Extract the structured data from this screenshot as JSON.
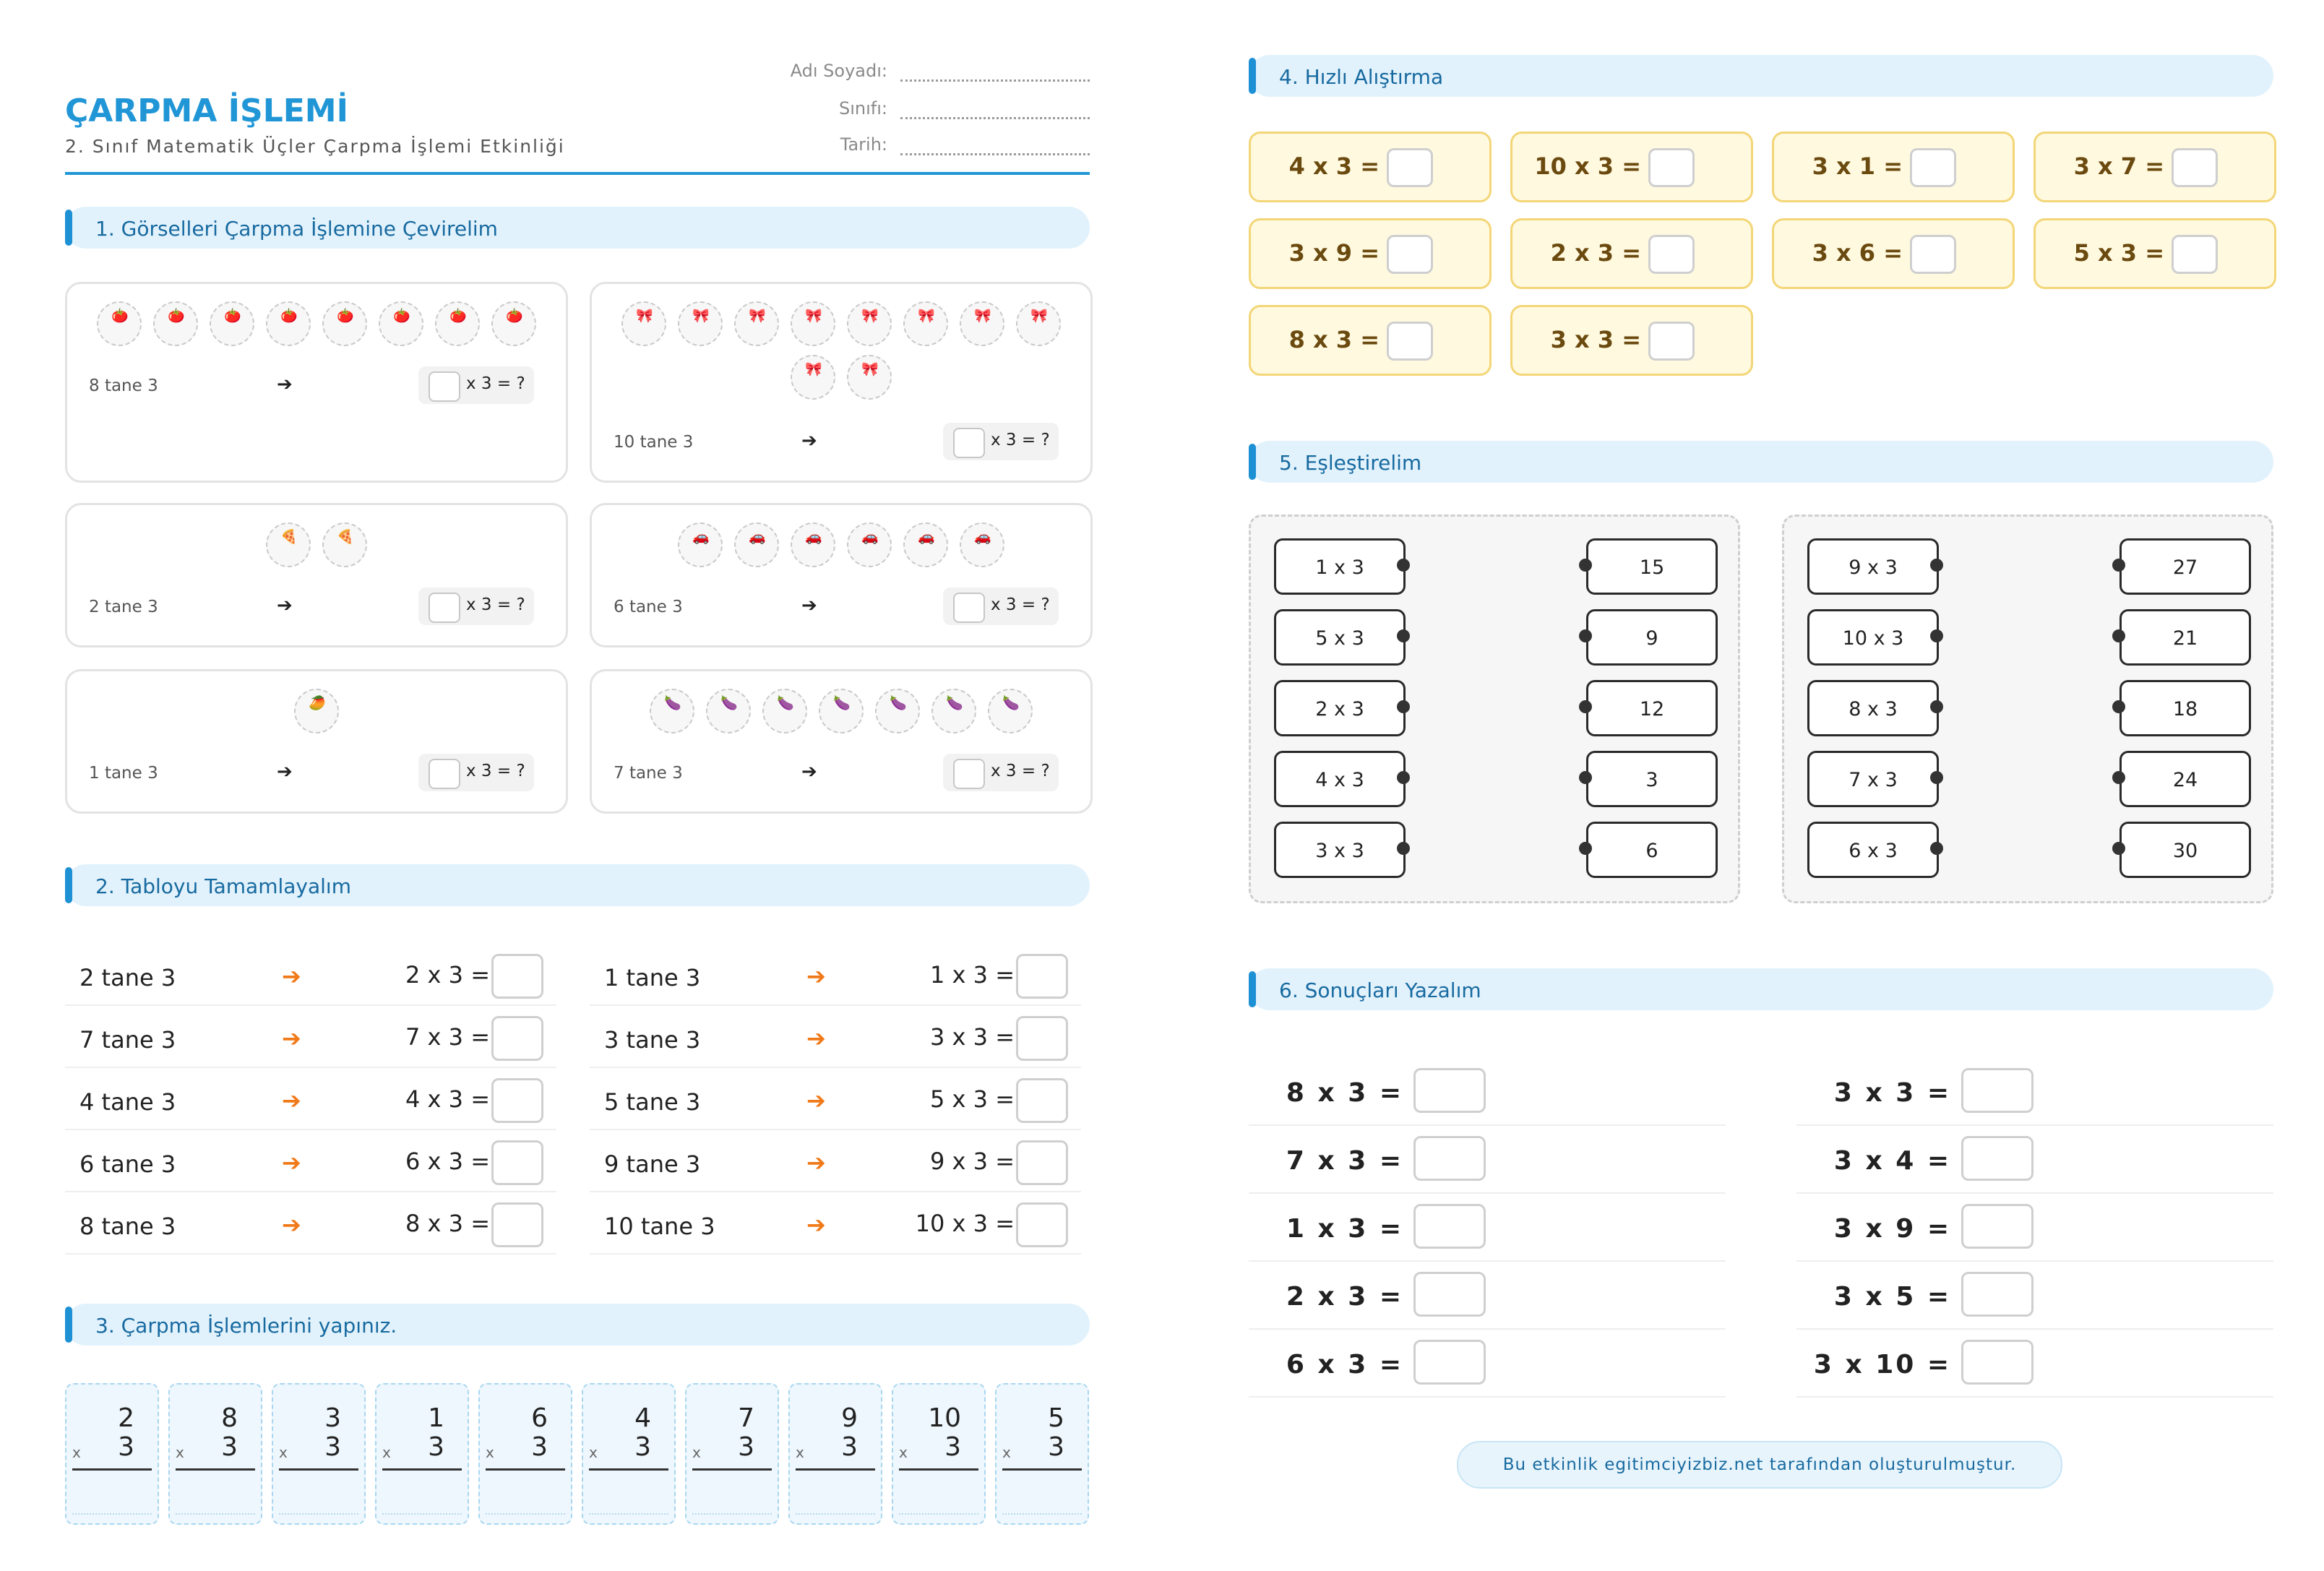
{
  "header": {
    "title": "ÇARPMA İŞLEMİ",
    "subtitle": "2. Sınıf Matematik Üçler Çarpma İşlemi Etkinliği",
    "fields": [
      "Adı Soyadı:",
      "Sınıfı:",
      "Tarih:"
    ]
  },
  "sections": {
    "s1": "1. Görselleri Çarpma İşlemine Çevirelim",
    "s2": "2. Tabloyu Tamamlayalım",
    "s3": "3. Çarpma İşlemlerini yapınız.",
    "s4": "4. Hızlı Alıştırma",
    "s5": "5. Eşleştirelim",
    "s6": "6. Sonuçları Yazalım"
  },
  "colors": {
    "accent": "#2196d6",
    "arrow": "#f07a1a",
    "fast_bg": "#fff9df",
    "fast_border": "#f3d678"
  },
  "arrow_glyph": "➔",
  "picture_cards": [
    {
      "caption": "8 tane 3",
      "question": "x 3 = ?",
      "icon": "🍅",
      "groups": 8
    },
    {
      "caption": "10 tane 3",
      "question": "x 3 = ?",
      "icon": "🎀",
      "groups": 10
    },
    {
      "caption": "2 tane 3",
      "question": "x 3 = ?",
      "icon": "🍕",
      "groups": 2
    },
    {
      "caption": "6 tane 3",
      "question": "x 3 = ?",
      "icon": "🚗",
      "groups": 6
    },
    {
      "caption": "1 tane 3",
      "question": "x 3 = ?",
      "icon": "🥭",
      "groups": 1
    },
    {
      "caption": "7 tane 3",
      "question": "x 3 = ?",
      "icon": "🍆",
      "groups": 7
    }
  ],
  "table_left": [
    {
      "label": "2 tane 3",
      "expr": "2 x 3 ="
    },
    {
      "label": "7 tane 3",
      "expr": "7 x 3 ="
    },
    {
      "label": "4 tane 3",
      "expr": "4 x 3 ="
    },
    {
      "label": "6 tane 3",
      "expr": "6 x 3 ="
    },
    {
      "label": "8 tane 3",
      "expr": "8 x 3 ="
    }
  ],
  "table_right": [
    {
      "label": "1 tane 3",
      "expr": "1 x 3 ="
    },
    {
      "label": "3 tane 3",
      "expr": "3 x 3 ="
    },
    {
      "label": "5 tane 3",
      "expr": "5 x 3 ="
    },
    {
      "label": "9 tane 3",
      "expr": "9 x 3 ="
    },
    {
      "label": "10 tane 3",
      "expr": "10 x 3 ="
    }
  ],
  "vertical": [
    {
      "top": "2",
      "bottom": "3"
    },
    {
      "top": "8",
      "bottom": "3"
    },
    {
      "top": "3",
      "bottom": "3"
    },
    {
      "top": "1",
      "bottom": "3"
    },
    {
      "top": "6",
      "bottom": "3"
    },
    {
      "top": "4",
      "bottom": "3"
    },
    {
      "top": "7",
      "bottom": "3"
    },
    {
      "top": "9",
      "bottom": "3"
    },
    {
      "top": "10",
      "bottom": "3"
    },
    {
      "top": "5",
      "bottom": "3"
    }
  ],
  "vertical_sign": "x",
  "fast": [
    "4 x 3 =",
    "10 x 3 =",
    "3 x 1 =",
    "3 x 7 =",
    "3 x 9 =",
    "2 x 3 =",
    "3 x 6 =",
    "5 x 3 =",
    "8 x 3 =",
    "3 x 3 ="
  ],
  "match": [
    {
      "left": [
        "1 x 3",
        "5 x 3",
        "2 x 3",
        "4 x 3",
        "3 x 3"
      ],
      "right": [
        "15",
        "9",
        "12",
        "3",
        "6"
      ]
    },
    {
      "left": [
        "9 x 3",
        "10 x 3",
        "8 x 3",
        "7 x 3",
        "6 x 3"
      ],
      "right": [
        "27",
        "21",
        "18",
        "24",
        "30"
      ]
    }
  ],
  "results_left": [
    "8 x 3 =",
    "7 x 3 =",
    "1 x 3 =",
    "2 x 3 =",
    "6 x 3 ="
  ],
  "results_right": [
    "3 x 3 =",
    "3 x 4 =",
    "3 x 9 =",
    "3 x 5 =",
    "3 x 10 ="
  ],
  "footer": "Bu etkinlik egitimciyizbiz.net tarafından oluşturulmuştur."
}
